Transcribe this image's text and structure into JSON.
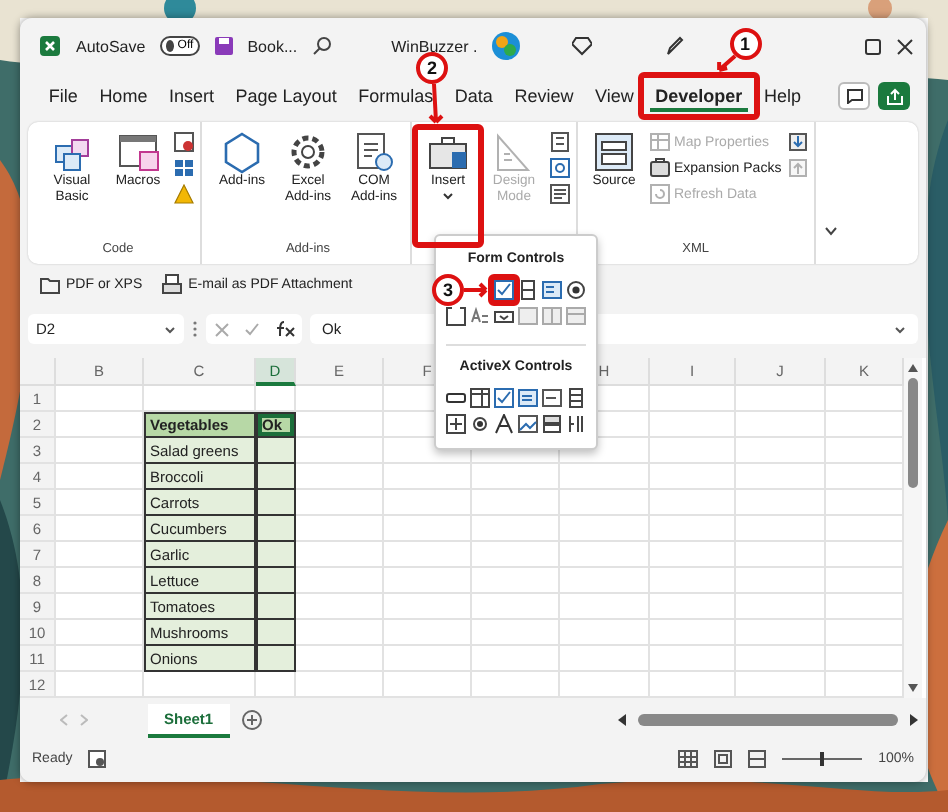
{
  "title_bar": {
    "autosave_label": "AutoSave",
    "autosave": {
      "on": false,
      "label": "Off"
    },
    "file_name": "Book...",
    "account": "WinBuzzer ."
  },
  "menu_tabs": [
    {
      "label": "File",
      "selected": false
    },
    {
      "label": "Home",
      "selected": false
    },
    {
      "label": "Insert",
      "selected": false
    },
    {
      "label": "Page Layout",
      "selected": false
    },
    {
      "label": "Formulas",
      "selected": false
    },
    {
      "label": "Data",
      "selected": false
    },
    {
      "label": "Review",
      "selected": false
    },
    {
      "label": "View",
      "selected": false
    },
    {
      "label": "Developer",
      "selected": true
    },
    {
      "label": "Help",
      "selected": false
    }
  ],
  "ribbon": {
    "groups": [
      {
        "label": "Code",
        "columns": [
          {
            "kind": "large",
            "label": "Visual Basic",
            "disabled": false,
            "dropdown": false
          },
          {
            "kind": "large",
            "label": "Macros",
            "disabled": false,
            "dropdown": false
          },
          {
            "kind": "stack",
            "items": [
              {
                "disabled": false
              },
              {
                "disabled": false
              },
              {
                "disabled": false
              }
            ]
          }
        ]
      },
      {
        "label": "Add-ins",
        "columns": [
          {
            "kind": "large",
            "label": "Add-ins",
            "disabled": false,
            "dropdown": false
          },
          {
            "kind": "large",
            "label": "Excel Add-ins",
            "disabled": false,
            "dropdown": false
          },
          {
            "kind": "large",
            "label": "COM Add-ins",
            "disabled": false,
            "dropdown": false
          }
        ]
      },
      {
        "columns": [
          {
            "kind": "large",
            "label": "Insert",
            "disabled": false,
            "dropdown": true
          },
          {
            "kind": "large",
            "label": "Design Mode",
            "disabled": true,
            "dropdown": false
          },
          {
            "kind": "stack",
            "items": [
              {
                "disabled": false
              },
              {
                "disabled": false
              },
              {
                "disabled": false
              }
            ]
          }
        ]
      },
      {
        "label": "XML",
        "columns": [
          {
            "kind": "large",
            "label": "Source",
            "disabled": false,
            "dropdown": false
          },
          {
            "kind": "stack",
            "items": [
              {
                "label": "Map Properties",
                "disabled": true
              },
              {
                "label": "Expansion Packs",
                "disabled": false
              },
              {
                "label": "Refresh Data",
                "disabled": true
              }
            ]
          },
          {
            "kind": "stack",
            "items": [
              {
                "disabled": false
              },
              {
                "disabled": true
              }
            ]
          }
        ]
      }
    ]
  },
  "quick_bar": [
    "PDF or XPS",
    "E-mail as PDF Attachment"
  ],
  "formula_bar": {
    "name_box": "D2",
    "formula": "Ok"
  },
  "insert_menu": {
    "sections": [
      {
        "title": "Form Controls"
      },
      {
        "title": "ActiveX Controls"
      }
    ]
  },
  "sheet": {
    "columns": [
      {
        "label": "B",
        "selected": false
      },
      {
        "label": "C",
        "selected": false
      },
      {
        "label": "D",
        "selected": true
      },
      {
        "label": "E",
        "selected": false
      },
      {
        "label": "F",
        "selected": false
      },
      null,
      {
        "label": "H",
        "selected": false
      },
      {
        "label": "I",
        "selected": false
      },
      {
        "label": "J",
        "selected": false
      },
      {
        "label": "K",
        "selected": false
      }
    ],
    "row_numbers": [
      "1",
      "2",
      "3",
      "4",
      "5",
      "6",
      "7",
      "8",
      "9",
      "10",
      "11",
      "12"
    ],
    "table": {
      "columns": [
        {
          "label": "Vegetables",
          "selected": false
        },
        {
          "label": "Ok",
          "selected": true
        }
      ],
      "rows": [
        "Salad greens",
        "Broccoli",
        "Carrots",
        "Cucumbers",
        "Garlic",
        "Lettuce",
        "Tomatoes",
        "Mushrooms",
        "Onions"
      ]
    }
  },
  "sheet_tabs": [
    {
      "label": "Sheet1",
      "selected": true
    }
  ],
  "status_bar": {
    "status": "Ready",
    "zoom_slider": {
      "level": 0.5
    },
    "zoom": "100%"
  },
  "callouts": [
    "1",
    "2",
    "3"
  ]
}
